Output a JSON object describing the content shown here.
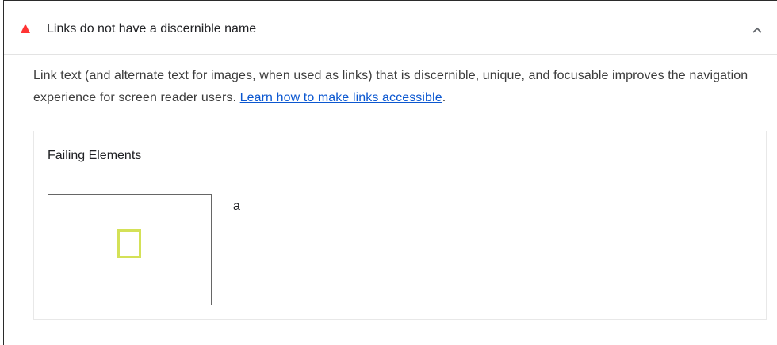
{
  "audit": {
    "title": "Links do not have a discernible name",
    "status": "fail",
    "status_color": "#ff3333",
    "expanded": true,
    "description_text": "Link text (and alternate text for images, when used as links) that is discernible, unique, and focusable improves the navigation experience for screen reader users. ",
    "learn_more_label": "Learn how to make links accessible",
    "description_end": "."
  },
  "details": {
    "header_label": "Failing Elements",
    "rows": [
      {
        "node_label": "a",
        "highlight_color": "#d4e157"
      }
    ]
  },
  "icons": {
    "status_icon": "fail-triangle-icon",
    "toggle_icon": "chevron-up-icon"
  }
}
